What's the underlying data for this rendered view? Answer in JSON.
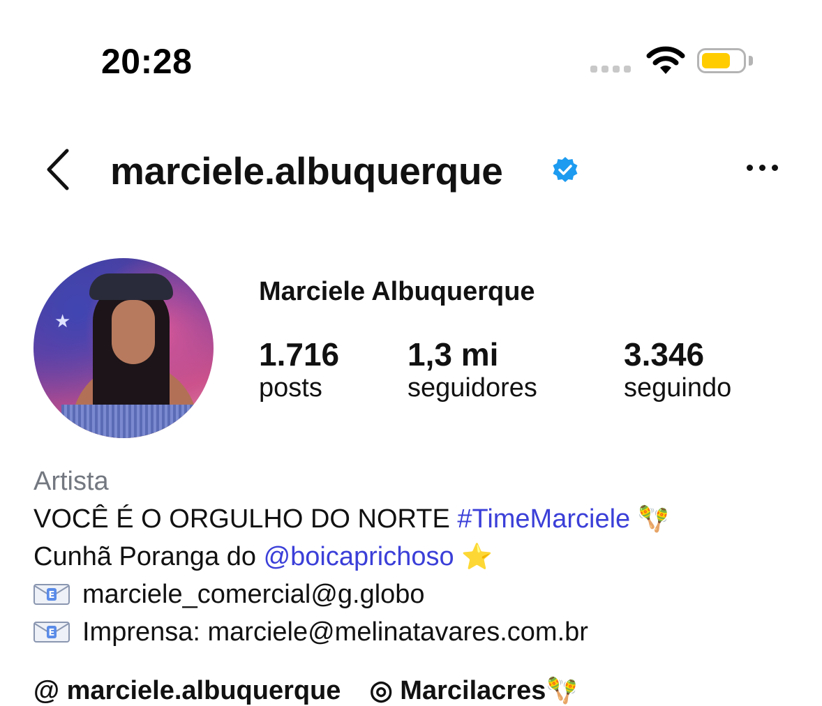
{
  "status_bar": {
    "time": "20:28"
  },
  "header": {
    "username": "marciele.albuquerque"
  },
  "profile": {
    "full_name": "Marciele Albuquerque",
    "stats": [
      {
        "value": "1.716",
        "label": "posts"
      },
      {
        "value": "1,3 mi",
        "label": "seguidores"
      },
      {
        "value": "3.346",
        "label": "seguindo"
      }
    ],
    "category": "Artista",
    "bio": {
      "line1_text": "VOCÊ É O ORGULHO DO NORTE ",
      "line1_hashtag": "#TimeMarciele",
      "line1_emoji": "🪇",
      "line2_text": "Cunhã Poranga do ",
      "line2_mention": "@boicaprichoso",
      "line2_emoji": "⭐",
      "line3_email": "marciele_comercial@g.globo",
      "line4_text": "Imprensa: marciele@melinatavares.com.br"
    },
    "links_row": {
      "threads_handle": "marciele.albuquerque",
      "whatsapp_label": "Marcilacres"
    }
  },
  "colors": {
    "link": "#3b3fd8",
    "verified": "#1d9bf0",
    "battery": "#ffcc00",
    "category": "#737880"
  }
}
